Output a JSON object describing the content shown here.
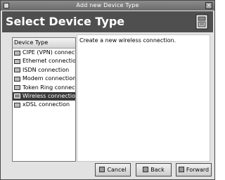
{
  "window": {
    "title": "Add new Device Type"
  },
  "header": {
    "heading": "Select Device Type"
  },
  "device_list": {
    "column_header": "Device Type",
    "items": [
      {
        "label": "CIPE (VPN) connecti",
        "icon": "network-icon",
        "selected": false
      },
      {
        "label": "Ethernet connection",
        "icon": "ethernet-icon",
        "selected": false
      },
      {
        "label": "ISDN connection",
        "icon": "isdn-icon",
        "selected": false
      },
      {
        "label": "Modem connection",
        "icon": "modem-icon",
        "selected": false
      },
      {
        "label": "Token Ring connectic",
        "icon": "token-ring-icon",
        "selected": false
      },
      {
        "label": "Wireless connection",
        "icon": "wireless-icon",
        "selected": true
      },
      {
        "label": "xDSL connection",
        "icon": "xdsl-icon",
        "selected": false
      }
    ]
  },
  "description": {
    "text": "Create a new wireless connection."
  },
  "buttons": {
    "cancel": "Cancel",
    "back": "Back",
    "forward": "Forward"
  },
  "colors": {
    "header_bg": "#4f4f4f",
    "selected_bg": "#3a3a3a"
  }
}
